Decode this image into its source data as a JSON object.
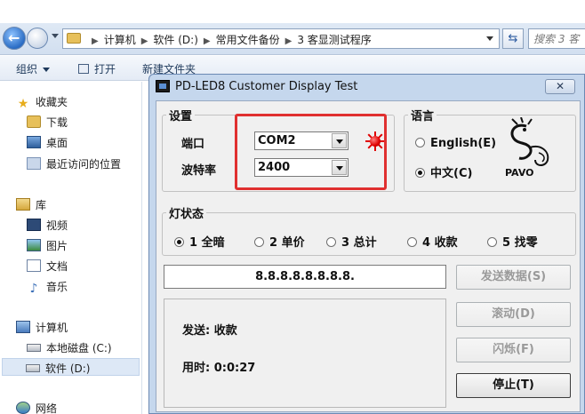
{
  "explorer": {
    "breadcrumbs": [
      "计算机",
      "软件 (D:)",
      "常用文件备份",
      "3 客显测试程序"
    ],
    "search_placeholder": "搜索 3 客",
    "toolbar": {
      "organize": "组织",
      "open": "打开",
      "new_folder": "新建文件夹"
    },
    "nav": {
      "favorites": "收藏夹",
      "favorites_items": [
        "下载",
        "桌面",
        "最近访问的位置"
      ],
      "libraries": "库",
      "library_items": [
        "视频",
        "图片",
        "文档",
        "音乐"
      ],
      "computer": "计算机",
      "drives": [
        "本地磁盘 (C:)",
        "软件 (D:)"
      ],
      "network": "网络",
      "selected": "软件 (D:)"
    }
  },
  "dialog": {
    "title": "PD-LED8 Customer Display Test",
    "close_glyph": "✕",
    "settings": {
      "legend": "设置",
      "port_label": "端口",
      "port_value": "COM2",
      "baud_label": "波特率",
      "baud_value": "2400",
      "status_led_color": "#e00000"
    },
    "language": {
      "legend": "语言",
      "options": [
        "English(E)",
        "中文(C)"
      ],
      "selected": "中文(C)",
      "logo_text": "PAVO"
    },
    "lamp_status": {
      "legend": "灯状态",
      "options": [
        "1 全暗",
        "2 单价",
        "3 总计",
        "4 收款",
        "5 找零"
      ],
      "selected": "1 全暗"
    },
    "display_value": "8.8.8.8.8.8.8.8.",
    "info": {
      "send_text": "发送: 收款",
      "time_text": "用时: 0:0:27"
    },
    "buttons": {
      "send": "发送数据(S)",
      "scroll": "滚动(D)",
      "blink": "闪烁(F)",
      "stop": "停止(T)"
    },
    "highlight_color": "#e03030"
  }
}
